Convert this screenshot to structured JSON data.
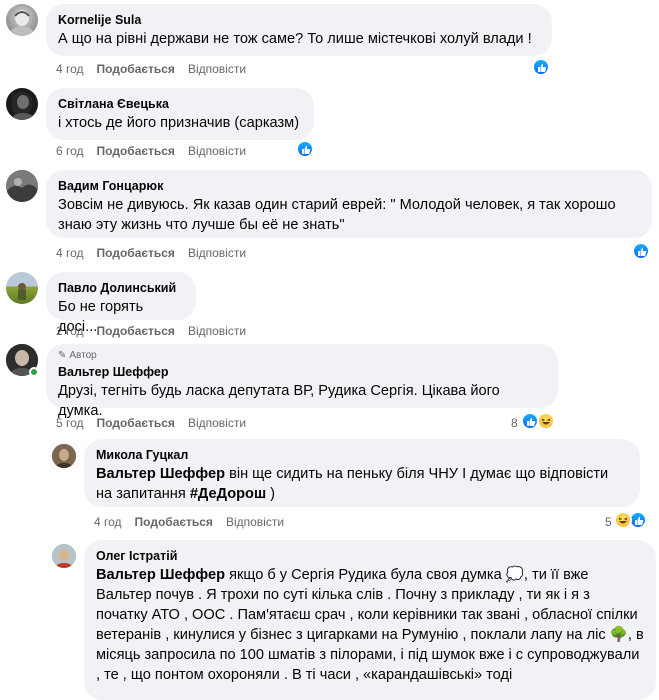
{
  "labels": {
    "like": "Подобається",
    "reply": "Відповісти",
    "author": "Автор"
  },
  "comments": [
    {
      "name": "Kornelije Sula",
      "text": "А що на рівні держави не тож саме? То лише містечкові холуй влади !",
      "time": "4 год"
    },
    {
      "name": "Світлана Євецька",
      "text": "і хтось де його призначив (сарказм)",
      "time": "6 год"
    },
    {
      "name": "Вадим Гонцарюк",
      "text": "Зовсім не дивуюсь. Як казав один старий еврей: \" Молодой человек, я так хорошо знаю эту жизнь что лучше бы её не знать\"",
      "time": "4 год"
    },
    {
      "name": "Павло Долинський",
      "text": "Бо не горять досі...",
      "time": "2 год"
    },
    {
      "name": "Вальтер Шеффер",
      "text": "Друзі, тегніть будь ласка депутата ВР, Рудика Сергія. Цікава його думка.",
      "time": "5 год",
      "reactions": "8"
    }
  ],
  "replies": [
    {
      "name": "Микола Гуцкал",
      "mention": "Вальтер Шеффер",
      "text": " він ще сидить на пеньку біля ЧНУ І думає що відповісти на запитання ",
      "hashtag": "#ДеДорош",
      "text_end": " )",
      "time": "4 год",
      "reactions": "5"
    },
    {
      "name": "Олег Істратій",
      "mention": "Вальтер Шеффер",
      "text": " якщо б у Сергія Рудика була своя думка 💭, ти її вже Вальтер почув . Я трохи по суті кілька слів . Почну з прикладу , ти як і я з початку АТО , ООС . Пам'ятаєш срач , коли керівники так звані , обласної спілки ветеранів , кинулися у бізнес з цигарками на Румунію , поклали лапу на ліс 🌳, в місяць запросила по 100 шматів з пілорами, і під шумок вже і с супроводжували , те , що понтом охороняли . В ті часи , «карандашівські» тоді"
    }
  ],
  "colors": {
    "bubble": "#f0f2f5",
    "meta": "#65676b",
    "like_blue": "#0866ff",
    "online": "#31a24c"
  }
}
